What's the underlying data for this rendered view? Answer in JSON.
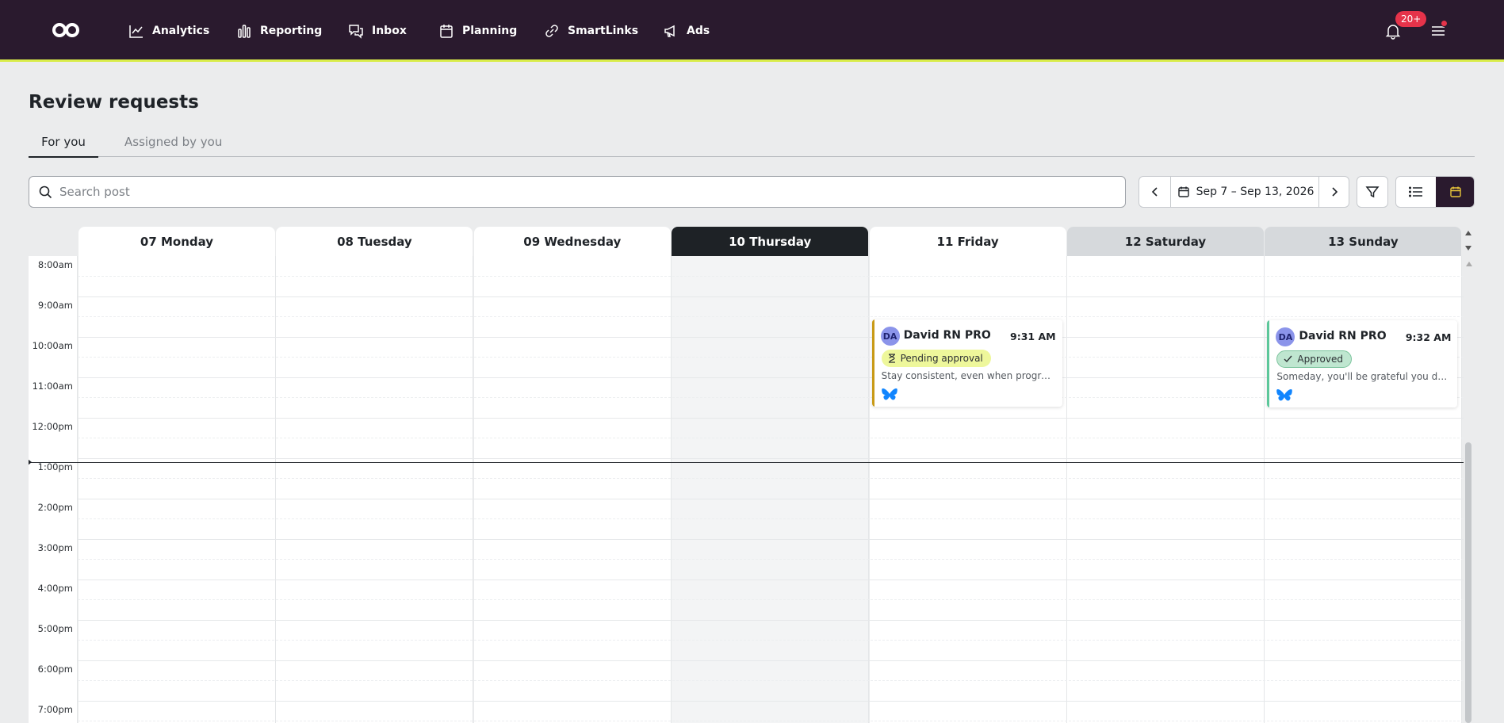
{
  "nav": {
    "items": [
      {
        "label": "Analytics",
        "icon": "analytics-icon"
      },
      {
        "label": "Reporting",
        "icon": "reporting-icon"
      },
      {
        "label": "Inbox",
        "icon": "inbox-icon"
      },
      {
        "label": "Planning",
        "icon": "planning-icon"
      },
      {
        "label": "SmartLinks",
        "icon": "link-icon"
      },
      {
        "label": "Ads",
        "icon": "megaphone-icon"
      }
    ],
    "notification_badge": "20+",
    "accent_color": "#d9ec4a",
    "bar_color": "#2a1a2e"
  },
  "page": {
    "title": "Review requests",
    "tabs": [
      {
        "label": "For you",
        "active": true
      },
      {
        "label": "Assigned by you",
        "active": false
      }
    ]
  },
  "toolbar": {
    "search_placeholder": "Search post",
    "search_value": "",
    "date_range": "Sep 7 – Sep 13, 2026",
    "view_mode": "calendar"
  },
  "calendar": {
    "days": [
      {
        "label": "07 Monday",
        "today": false,
        "weekend": false
      },
      {
        "label": "08 Tuesday",
        "today": false,
        "weekend": false
      },
      {
        "label": "09 Wednesday",
        "today": false,
        "weekend": false
      },
      {
        "label": "10 Thursday",
        "today": true,
        "weekend": false
      },
      {
        "label": "11 Friday",
        "today": false,
        "weekend": false
      },
      {
        "label": "12 Saturday",
        "today": false,
        "weekend": true
      },
      {
        "label": "13 Sunday",
        "today": false,
        "weekend": true
      }
    ],
    "times": [
      "8:00am",
      "9:00am",
      "10:00am",
      "11:00am",
      "12:00pm",
      "1:00pm",
      "2:00pm",
      "3:00pm",
      "4:00pm",
      "5:00pm",
      "6:00pm",
      "7:00pm"
    ],
    "posts": [
      {
        "initials": "DA",
        "name": "David RN PRO",
        "time": "9:31 AM",
        "status": "Pending approval",
        "status_type": "pending",
        "status_color": "#c89a16",
        "text": "Stay consistent, even when progress is slow.",
        "network": "butterfly-icon"
      },
      {
        "initials": "DA",
        "name": "David RN PRO",
        "time": "9:32 AM",
        "status": "Approved",
        "status_type": "approved",
        "status_color": "#5cc79a",
        "text": "Someday, you'll be grateful you didn't give up.",
        "network": "butterfly-icon"
      }
    ]
  }
}
